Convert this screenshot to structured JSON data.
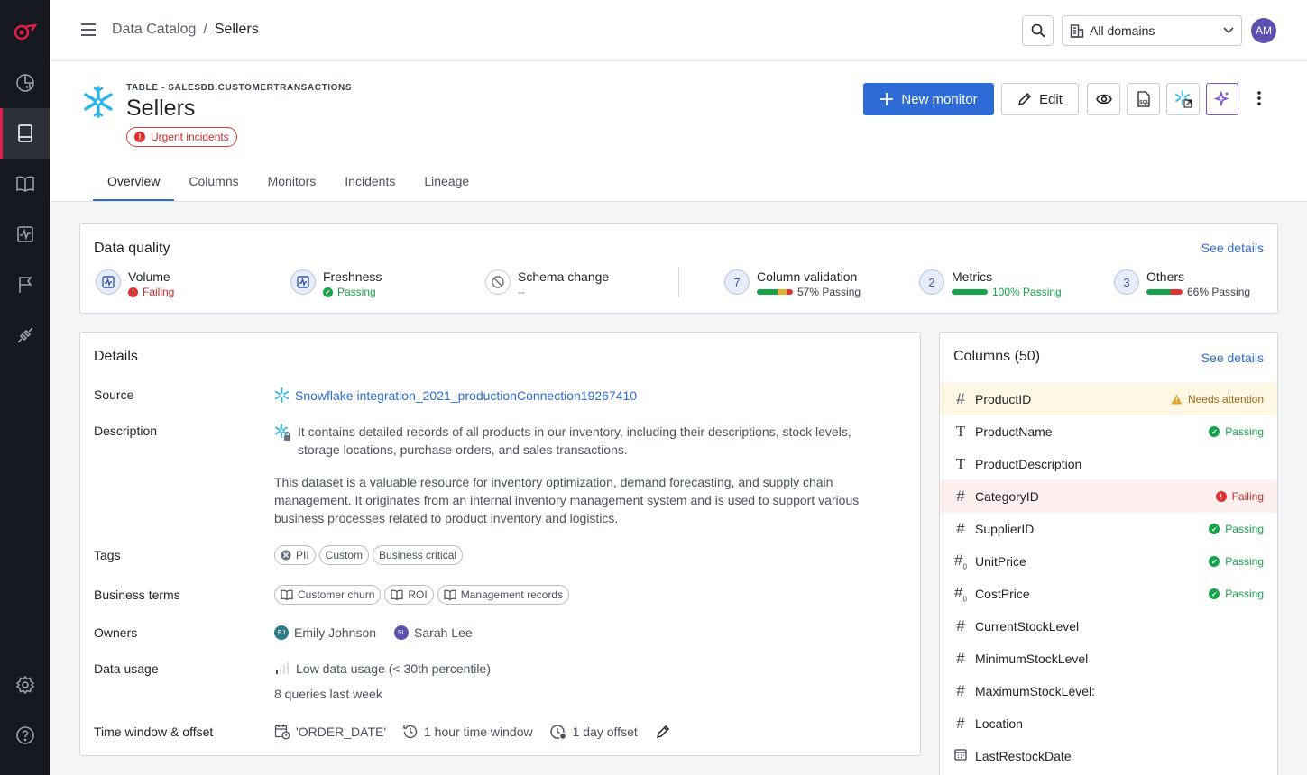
{
  "topbar": {
    "breadcrumb_root": "Data Catalog",
    "breadcrumb_sep": "/",
    "breadcrumb_current": "Sellers",
    "domain_select": "All domains",
    "avatar": "AM"
  },
  "header": {
    "table_type": "TABLE - SALESDB.CUSTOMERTRANSACTIONS",
    "title": "Sellers",
    "urgent_badge": "Urgent incidents",
    "new_monitor": "New monitor",
    "edit": "Edit"
  },
  "tabs": [
    "Overview",
    "Columns",
    "Monitors",
    "Incidents",
    "Lineage"
  ],
  "data_quality": {
    "title": "Data quality",
    "see_details": "See details",
    "items": [
      {
        "label": "Volume",
        "status": "Failing"
      },
      {
        "label": "Freshness",
        "status": "Passing"
      },
      {
        "label": "Schema change",
        "status": "--"
      },
      {
        "label": "Column validation",
        "count": "7",
        "status": "57% Passing",
        "pass_fraction": 0.57
      },
      {
        "label": "Metrics",
        "count": "2",
        "status": "100% Passing",
        "pass_fraction": 1.0
      },
      {
        "label": "Others",
        "count": "3",
        "status": "66% Passing",
        "pass_fraction": 0.66
      }
    ]
  },
  "details": {
    "title": "Details",
    "source_label": "Source",
    "source_value": "Snowflake integration_2021_productionConnection19267410",
    "description_label": "Description",
    "description_1": "It contains detailed records of all products in our inventory, including their descriptions, stock levels, storage locations, purchase orders, and sales transactions.",
    "description_2": "This dataset is a valuable resource for inventory optimization, demand forecasting, and supply chain management. It originates from an internal inventory management system and is used to support various business processes related to product inventory and logistics.",
    "tags_label": "Tags",
    "tags": [
      "PII",
      "Custom",
      "Business critical"
    ],
    "terms_label": "Business terms",
    "terms": [
      "Customer churn",
      "ROI",
      "Management records"
    ],
    "owners_label": "Owners",
    "owners": [
      {
        "initials": "EJ",
        "name": "Emily Johnson"
      },
      {
        "initials": "SL",
        "name": "Sarah Lee"
      }
    ],
    "usage_label": "Data usage",
    "usage_value": "Low data usage (< 30th percentile)",
    "usage_link": "8 queries last week",
    "window_label": "Time window & offset",
    "window_field": "'ORDER_DATE'",
    "window_value": "1 hour time window",
    "offset_value": "1 day offset"
  },
  "columns": {
    "title": "Columns (50)",
    "see_details": "See details",
    "items": [
      {
        "type": "#",
        "name": "ProductID",
        "status": "Needs attention"
      },
      {
        "type": "T",
        "name": "ProductName",
        "status": "Passing"
      },
      {
        "type": "T",
        "name": "ProductDescription",
        "status": ""
      },
      {
        "type": "#",
        "name": "CategoryID",
        "status": "Failing"
      },
      {
        "type": "#",
        "name": "SupplierID",
        "status": "Passing"
      },
      {
        "type": "#0",
        "name": "UnitPrice",
        "status": "Passing"
      },
      {
        "type": "#0",
        "name": "CostPrice",
        "status": "Passing"
      },
      {
        "type": "#",
        "name": "CurrentStockLevel",
        "status": ""
      },
      {
        "type": "#",
        "name": "MinimumStockLevel",
        "status": ""
      },
      {
        "type": "#",
        "name": "MaximumStockLevel:",
        "status": ""
      },
      {
        "type": "#",
        "name": "Location",
        "status": ""
      },
      {
        "type": "date",
        "name": "LastRestockDate",
        "status": ""
      }
    ]
  },
  "colors": {
    "accent": "#2e6bd6",
    "pass": "#17a34a",
    "fail": "#c22b2b",
    "warn": "#b7791f",
    "rail": "#15191f"
  }
}
